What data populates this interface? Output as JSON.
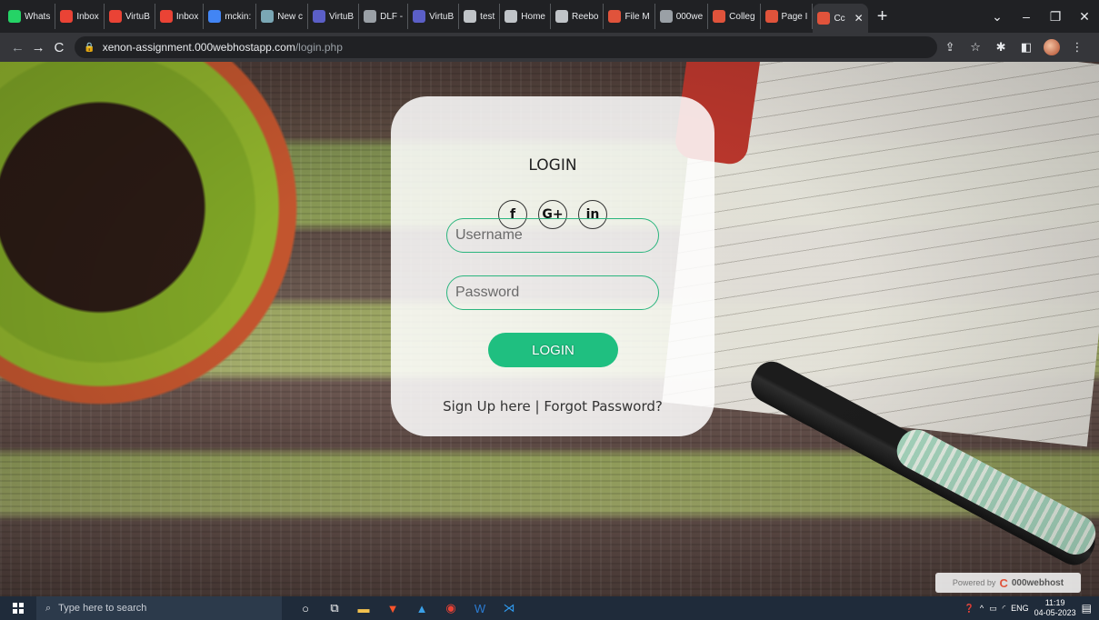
{
  "browser": {
    "tabs": [
      {
        "title": "Whats",
        "favicon": "whatsapp-icon",
        "color": "#25d366"
      },
      {
        "title": "Inbox",
        "favicon": "gmail-icon",
        "color": "#ea4335"
      },
      {
        "title": "VirtuB",
        "favicon": "gmail-icon",
        "color": "#ea4335"
      },
      {
        "title": "Inbox",
        "favicon": "gmail-icon",
        "color": "#ea4335"
      },
      {
        "title": "mckin:",
        "favicon": "google-icon",
        "color": "#4285f4"
      },
      {
        "title": "New c",
        "favicon": "page-icon",
        "color": "#7aa7b5"
      },
      {
        "title": "VirtuB",
        "favicon": "teams-icon",
        "color": "#5b5fc7"
      },
      {
        "title": "DLF -",
        "favicon": "gear-icon",
        "color": "#9aa0a6"
      },
      {
        "title": "VirtuB",
        "favicon": "teams-icon",
        "color": "#5b5fc7"
      },
      {
        "title": "test",
        "favicon": "page-icon",
        "color": "#c0c4c8"
      },
      {
        "title": "Home",
        "favicon": "page-icon",
        "color": "#c0c4c8"
      },
      {
        "title": "Reebo",
        "favicon": "page-icon",
        "color": "#c0c4c8"
      },
      {
        "title": "File M",
        "favicon": "webhost-icon",
        "color": "#e0533b"
      },
      {
        "title": "000we",
        "favicon": "webhost-icon",
        "color": "#9aa0a6"
      },
      {
        "title": "Colleg",
        "favicon": "heart-icon",
        "color": "#e0533b"
      },
      {
        "title": "Page I",
        "favicon": "webhost-icon",
        "color": "#e0533b"
      }
    ],
    "active_tab": {
      "title": "Cc",
      "favicon": "heart-icon",
      "color": "#e0533b"
    },
    "url_host": "xenon-assignment.000webhostapp.com",
    "url_path": "/login.php"
  },
  "login": {
    "title": "LOGIN",
    "social": [
      {
        "label": "f",
        "icon": "facebook-icon"
      },
      {
        "label": "G+",
        "icon": "google-plus-icon"
      },
      {
        "label": "in",
        "icon": "linkedin-icon"
      }
    ],
    "username_placeholder": "Username",
    "password_placeholder": "Password",
    "button_label": "LOGIN",
    "signup_link": "Sign Up here",
    "separator": "|",
    "forgot_link": "Forgot Password?"
  },
  "badge": {
    "prefix": "Powered by",
    "brand": "000webhost"
  },
  "taskbar": {
    "search_placeholder": "Type here to search",
    "language": "ENG",
    "time": "11:19",
    "date": "04-05-2023"
  },
  "colors": {
    "accent": "#1fbf80",
    "field_border": "#2bb57e"
  }
}
